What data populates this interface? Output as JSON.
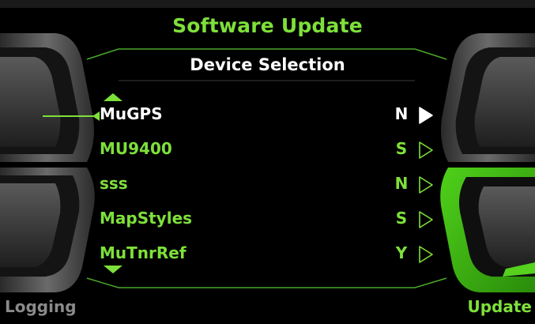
{
  "header": {
    "title": "Software Update"
  },
  "panel": {
    "title": "Device Selection"
  },
  "devices": [
    {
      "name": "MuGPS",
      "flag": "N",
      "selected": true
    },
    {
      "name": "MU9400",
      "flag": "S",
      "selected": false
    },
    {
      "name": "sss",
      "flag": "N",
      "selected": false
    },
    {
      "name": "MapStyles",
      "flag": "S",
      "selected": false
    },
    {
      "name": "MuTnrRef",
      "flag": "Y",
      "selected": false
    }
  ],
  "icons": {
    "scroll_up": "triangle-up-icon",
    "scroll_down": "triangle-down-icon",
    "row_action": "play-arrow-icon",
    "selection_pointer": "pointer-line-icon"
  },
  "softkeys": {
    "left": "Logging",
    "right": "Update"
  },
  "colors": {
    "accent": "#7ee03a",
    "text_selected": "#ffffff",
    "softkey_disabled": "#8a8a8a",
    "background": "#000000"
  }
}
